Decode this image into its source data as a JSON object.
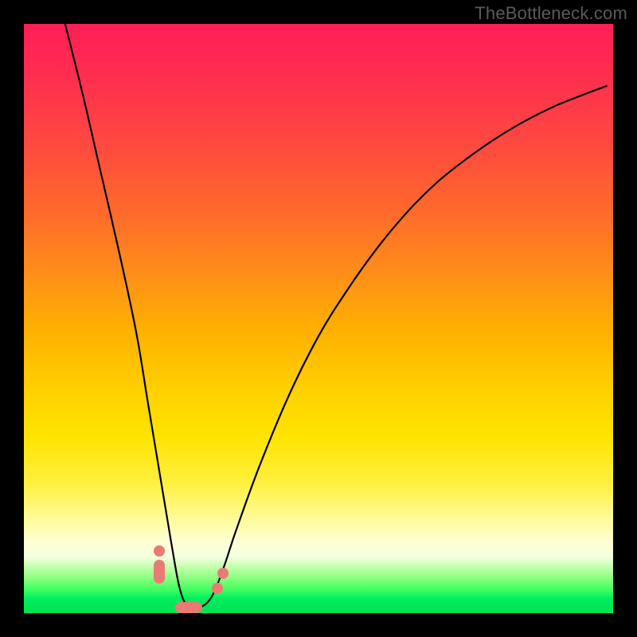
{
  "watermark": "TheBottleneck.com",
  "chart_data": {
    "type": "line",
    "title": "",
    "xlabel": "",
    "ylabel": "",
    "xlim": [
      0,
      100
    ],
    "ylim": [
      0,
      100
    ],
    "series": [
      {
        "name": "bottleneck-curve",
        "x": [
          7,
          10,
          13,
          16,
          19,
          21,
          23,
          25,
          26.5,
          28,
          30,
          32,
          34,
          36,
          40,
          45,
          50,
          55,
          60,
          65,
          70,
          75,
          80,
          85,
          90,
          95,
          99
        ],
        "values": [
          100,
          88,
          75,
          62,
          48,
          36,
          24,
          12,
          4,
          1,
          1,
          3,
          8,
          14,
          25,
          37,
          47,
          55,
          62,
          68,
          73,
          77,
          80.5,
          83.5,
          86,
          88,
          89.5
        ]
      }
    ],
    "markers": [
      {
        "shape": "capsule-vertical",
        "x": 23.0,
        "y": 7.0
      },
      {
        "shape": "dot",
        "x": 23.0,
        "y": 10.5
      },
      {
        "shape": "capsule-horizontal",
        "x": 28.0,
        "y": 1.0
      },
      {
        "shape": "dot",
        "x": 32.8,
        "y": 4.2
      },
      {
        "shape": "dot",
        "x": 33.8,
        "y": 6.8
      }
    ],
    "gradient_stops": [
      {
        "pos": 0,
        "color": "#ff1f57"
      },
      {
        "pos": 50,
        "color": "#ffb000"
      },
      {
        "pos": 80,
        "color": "#fffb9a"
      },
      {
        "pos": 100,
        "color": "#00e356"
      }
    ]
  }
}
